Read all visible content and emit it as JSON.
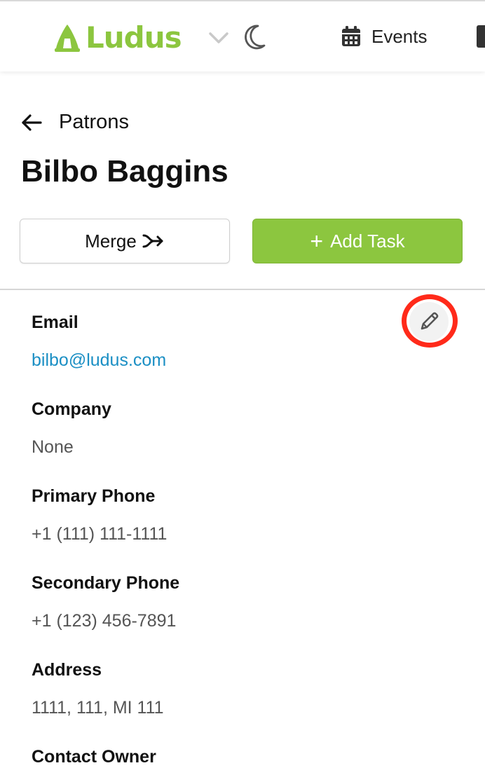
{
  "header": {
    "brand": "Ludus",
    "nav_events_label": "Events",
    "brand_color": "#8cc63f"
  },
  "breadcrumb": {
    "back_label": "Patrons"
  },
  "page": {
    "title": "Bilbo Baggins"
  },
  "actions": {
    "merge_label": "Merge",
    "add_task_label": "Add Task"
  },
  "fields": {
    "email": {
      "label": "Email",
      "value": "bilbo@ludus.com"
    },
    "company": {
      "label": "Company",
      "value": "None"
    },
    "primary_phone": {
      "label": "Primary Phone",
      "value": "+1 (111) 111-1111"
    },
    "secondary_phone": {
      "label": "Secondary Phone",
      "value": "+1 (123) 456-7891"
    },
    "address": {
      "label": "Address",
      "value": "1111, 111, MI 111"
    },
    "contact_owner": {
      "label": "Contact Owner"
    }
  },
  "icons": {
    "logo": "ludus-logo-icon",
    "dropdown": "chevron-down-icon",
    "theme": "moon-icon",
    "events": "calendar-icon",
    "back": "arrow-left-icon",
    "merge": "merge-icon",
    "add": "plus-icon",
    "edit": "pencil-icon"
  },
  "colors": {
    "accent_green": "#8cc63f",
    "link_blue": "#1b8fc4",
    "highlight_ring": "#ff2a1a"
  }
}
